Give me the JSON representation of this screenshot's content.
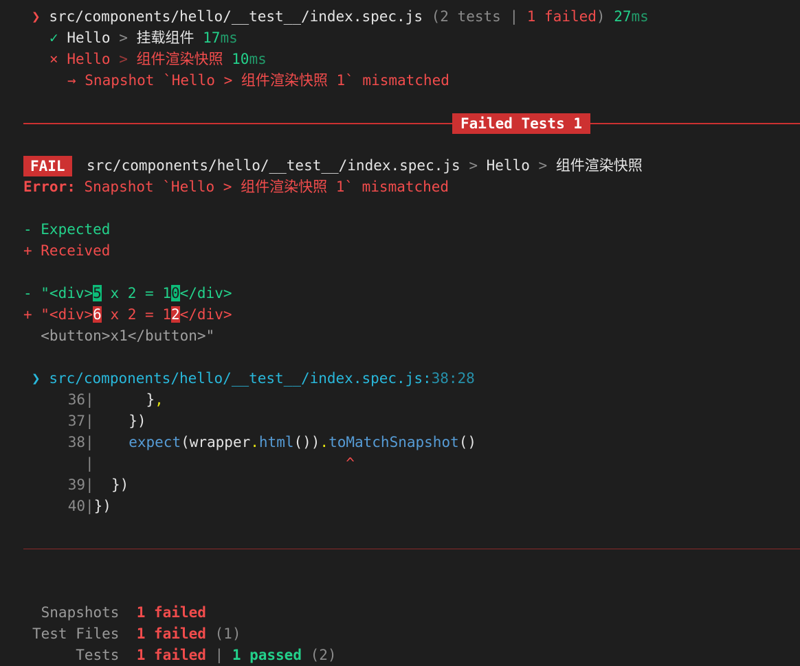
{
  "summary_header": {
    "arrow": "❯",
    "file": "src/components/hello/__test__/index.spec.js",
    "counts_open": "(2 tests",
    "sep": "|",
    "failed": "1 failed",
    "counts_close": ")",
    "duration_num": "27",
    "duration_unit": "ms"
  },
  "tests": [
    {
      "mark": "✓",
      "suite": "Hello",
      "chev": ">",
      "name": "挂载组件",
      "dur_num": "17",
      "dur_unit": "ms"
    },
    {
      "mark": "×",
      "suite": "Hello",
      "chev": ">",
      "name": "组件渲染快照",
      "dur_num": "10",
      "dur_unit": "ms"
    }
  ],
  "failure_note": "→ Snapshot `Hello > 组件渲染快照 1` mismatched",
  "failed_tests_banner": "Failed Tests 1",
  "fail_block": {
    "badge": "FAIL",
    "file": "src/components/hello/__test__/index.spec.js",
    "chev1": ">",
    "suite": "Hello",
    "chev2": ">",
    "name": "组件渲染快照",
    "error_label": "Error:",
    "error_msg": " Snapshot `Hello > 组件渲染快照 1` mismatched"
  },
  "legend": {
    "expected": "- Expected",
    "received": "+ Received"
  },
  "diff": {
    "expected": {
      "prefix": "- \"<div>",
      "hl1": "5",
      "mid": " x 2 = 1",
      "hl2": "0",
      "suffix": "</div>"
    },
    "received": {
      "prefix": "+ \"<div>",
      "hl1": "6",
      "mid": " x 2 = 1",
      "hl2": "2",
      "suffix": "</div>"
    },
    "common": "  <button>x1</button>\""
  },
  "location": {
    "arrow": "❯",
    "path": "src/components/hello/__test__/index.spec.js:",
    "pos": "38:28"
  },
  "code": [
    {
      "num": "36",
      "parts": [
        {
          "t": "      }",
          "c": "white"
        },
        {
          "t": ",",
          "c": "yellow"
        }
      ]
    },
    {
      "num": "37",
      "parts": [
        {
          "t": "    })",
          "c": "white"
        }
      ]
    },
    {
      "num": "38",
      "parts": [
        {
          "t": "    ",
          "c": "white"
        },
        {
          "t": "expect",
          "c": "blue"
        },
        {
          "t": "(wrapper",
          "c": "white"
        },
        {
          "t": ".",
          "c": "yellow"
        },
        {
          "t": "html",
          "c": "blue"
        },
        {
          "t": "())",
          "c": "white"
        },
        {
          "t": ".",
          "c": "yellow"
        },
        {
          "t": "toMatchSnapshot",
          "c": "blue"
        },
        {
          "t": "()",
          "c": "white"
        }
      ]
    },
    {
      "num": "",
      "parts": [
        {
          "t": "                             ^",
          "c": "red"
        }
      ]
    },
    {
      "num": "39",
      "parts": [
        {
          "t": "  })",
          "c": "white"
        }
      ]
    },
    {
      "num": "40",
      "parts": [
        {
          "t": "})",
          "c": "white"
        }
      ]
    }
  ],
  "stats": [
    {
      "label": " Snapshots",
      "failed": "1 failed",
      "rest": []
    },
    {
      "label": "Test Files",
      "failed": "1 failed",
      "rest": [
        {
          "t": " (1)",
          "c": "dim"
        }
      ]
    },
    {
      "label": "     Tests",
      "failed": "1 failed",
      "rest": [
        {
          "t": " | ",
          "c": "dim"
        },
        {
          "t": "1 passed",
          "c": "green bold"
        },
        {
          "t": " (2)",
          "c": "dim"
        }
      ]
    }
  ],
  "colors": {
    "fail_red": "#cd3131",
    "pass_green": "#0dbc79",
    "background": "#1e1e1e",
    "link_cyan": "#29b8db"
  }
}
